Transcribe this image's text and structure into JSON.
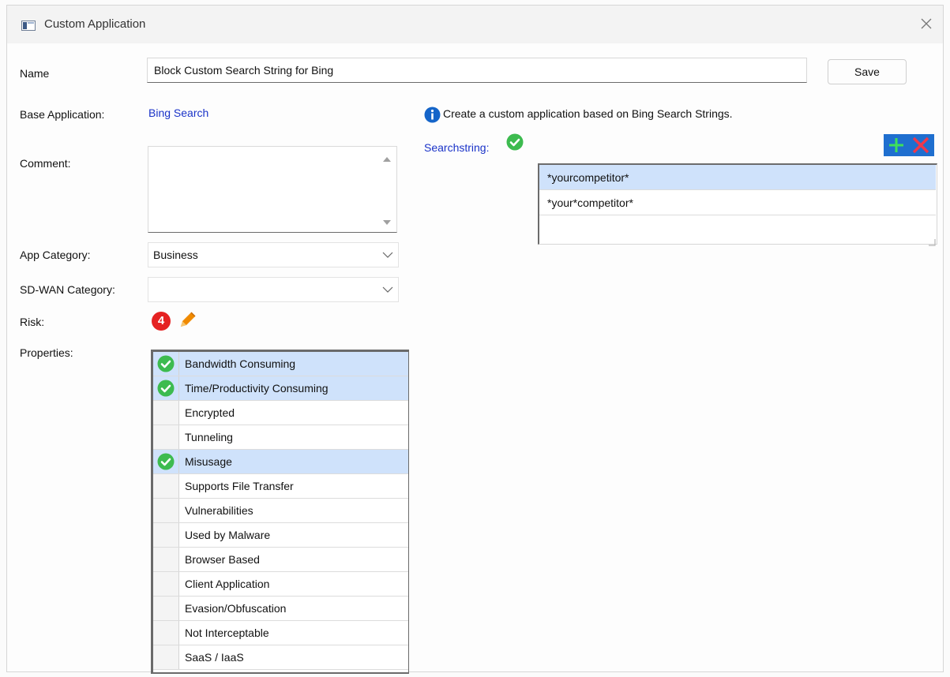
{
  "window": {
    "title": "Custom Application"
  },
  "form": {
    "name_label": "Name",
    "name_value": "Block Custom Search String for Bing",
    "save_label": "Save",
    "base_app_label": "Base Application:",
    "base_app_value": "Bing Search",
    "comment_label": "Comment:",
    "comment_value": "",
    "app_category_label": "App Category:",
    "app_category_value": "Business",
    "sdwan_category_label": "SD-WAN Category:",
    "sdwan_category_value": "",
    "risk_label": "Risk:",
    "risk_value": "4",
    "properties_label": "Properties:"
  },
  "properties": [
    {
      "label": "Bandwidth Consuming",
      "checked": true
    },
    {
      "label": "Time/Productivity Consuming",
      "checked": true
    },
    {
      "label": "Encrypted",
      "checked": false
    },
    {
      "label": "Tunneling",
      "checked": false
    },
    {
      "label": "Misusage",
      "checked": true
    },
    {
      "label": "Supports File Transfer",
      "checked": false
    },
    {
      "label": "Vulnerabilities",
      "checked": false
    },
    {
      "label": "Used by Malware",
      "checked": false
    },
    {
      "label": "Browser Based",
      "checked": false
    },
    {
      "label": "Client Application",
      "checked": false
    },
    {
      "label": "Evasion/Obfuscation",
      "checked": false
    },
    {
      "label": "Not Interceptable",
      "checked": false
    },
    {
      "label": "SaaS / IaaS",
      "checked": false
    }
  ],
  "info": {
    "text": "Create a custom application based on Bing Search Strings."
  },
  "searchstring": {
    "label": "Searchstring:",
    "items": [
      "*yourcompetitor*",
      "*your*competitor*"
    ]
  },
  "colors": {
    "accent_blue": "#1a33c8",
    "check_green": "#3dbb4f",
    "risk_red": "#e52222",
    "pencil_orange": "#f08a00",
    "selection": "#cfe2fb"
  }
}
